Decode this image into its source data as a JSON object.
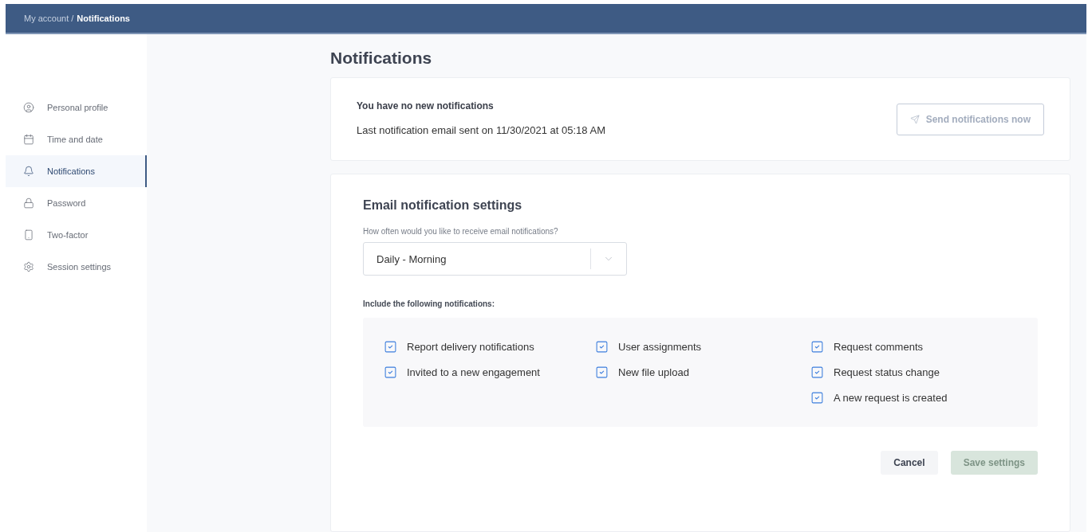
{
  "breadcrumb": {
    "parent": "My account /",
    "current": "Notifications"
  },
  "sidebar": {
    "items": [
      {
        "label": "Personal profile",
        "selected": false
      },
      {
        "label": "Time and date",
        "selected": false
      },
      {
        "label": "Notifications",
        "selected": true
      },
      {
        "label": "Password",
        "selected": false
      },
      {
        "label": "Two-factor",
        "selected": false
      },
      {
        "label": "Session settings",
        "selected": false
      }
    ]
  },
  "page_title": "Notifications",
  "status_card": {
    "heading": "You have no new notifications",
    "last_sent": "Last notification email sent on 11/30/2021 at 05:18 AM",
    "send_button": {
      "label": "Send notifications now",
      "disabled": true
    }
  },
  "settings_card": {
    "title": "Email notification settings",
    "frequency_label": "How often would you like to receive email notifications?",
    "frequency_value": "Daily - Morning",
    "include_label": "Include the following notifications:",
    "columns": [
      [
        {
          "label": "Report delivery notifications",
          "checked": true
        },
        {
          "label": "Invited to a new engagement",
          "checked": true
        }
      ],
      [
        {
          "label": "User assignments",
          "checked": true
        },
        {
          "label": "New file upload",
          "checked": true
        }
      ],
      [
        {
          "label": "Request comments",
          "checked": true
        },
        {
          "label": "Request status change",
          "checked": true
        },
        {
          "label": "A new request is created",
          "checked": true
        }
      ]
    ],
    "cancel_button": {
      "label": "Cancel",
      "disabled": false
    },
    "save_button": {
      "label": "Save settings",
      "disabled": true
    }
  }
}
